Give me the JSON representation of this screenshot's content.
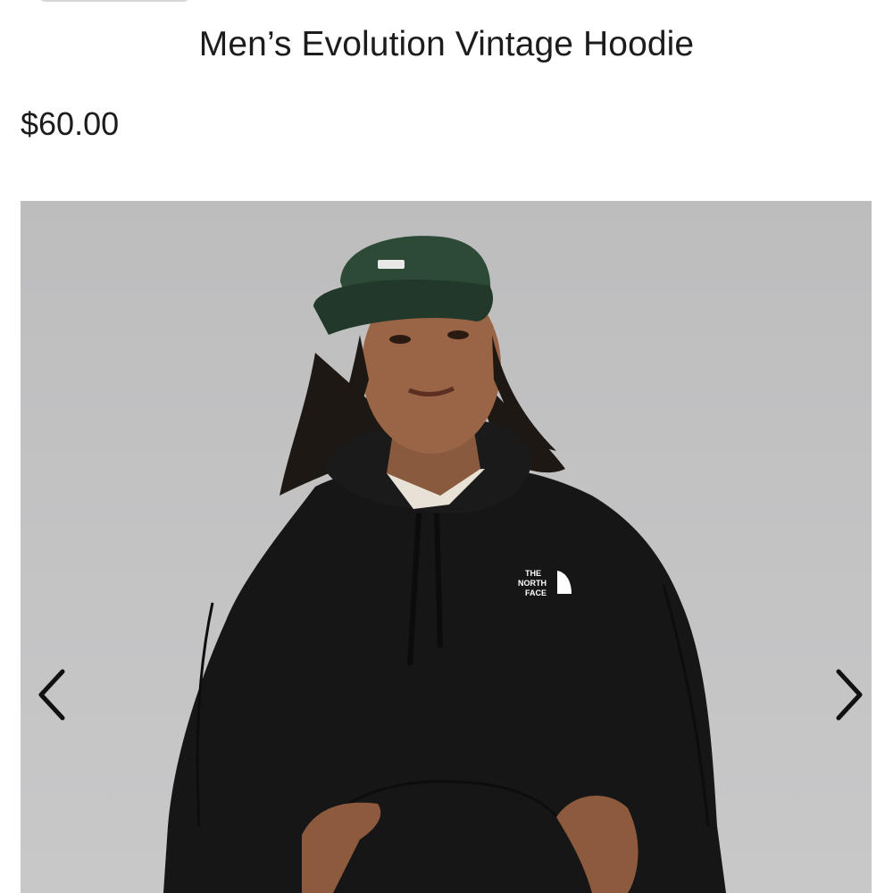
{
  "product": {
    "title": "Men’s Evolution Vintage Hoodie",
    "price": "$60.00"
  },
  "gallery": {
    "image_name": "hoodie-model-photo",
    "prev_icon": "chevron-left-icon",
    "next_icon": "chevron-right-icon",
    "logo_lines": [
      "THE",
      "NORTH",
      "FACE"
    ]
  },
  "colors": {
    "background": "#ffffff",
    "text": "#1c1c1c",
    "photo_backdrop": "#c3c3c4",
    "hoodie": "#161616",
    "cap": "#2c4a35"
  }
}
